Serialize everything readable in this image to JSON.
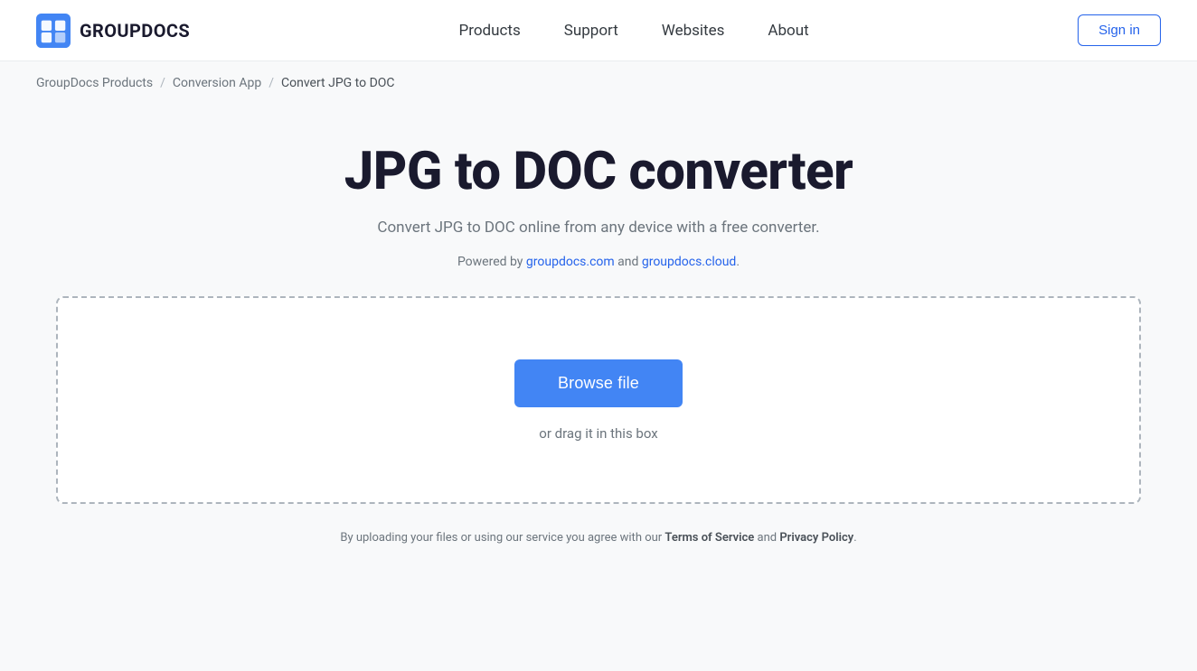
{
  "header": {
    "logo_text": "GROUPDOCS",
    "nav_items": [
      {
        "label": "Products",
        "id": "products"
      },
      {
        "label": "Support",
        "id": "support"
      },
      {
        "label": "Websites",
        "id": "websites"
      },
      {
        "label": "About",
        "id": "about"
      }
    ],
    "sign_in_label": "Sign in"
  },
  "breadcrumb": {
    "items": [
      {
        "label": "GroupDocs Products",
        "id": "groupdocs-products"
      },
      {
        "label": "Conversion App",
        "id": "conversion-app"
      },
      {
        "label": "Convert JPG to DOC",
        "id": "current"
      }
    ]
  },
  "main": {
    "title": "JPG to DOC converter",
    "subtitle": "Convert JPG to DOC online from any device with a free converter.",
    "powered_by_prefix": "Powered by ",
    "powered_by_link1": "groupdocs.com",
    "powered_by_link1_url": "https://groupdocs.com",
    "powered_by_middle": " and ",
    "powered_by_link2": "groupdocs.cloud",
    "powered_by_link2_url": "https://groupdocs.cloud",
    "powered_by_suffix": ".",
    "browse_button_label": "Browse file",
    "drag_hint": "or drag it in this box"
  },
  "footer": {
    "prefix": "By uploading your files or using our service you agree with our ",
    "tos_label": "Terms of Service",
    "middle": " and ",
    "privacy_label": "Privacy Policy",
    "suffix": "."
  }
}
